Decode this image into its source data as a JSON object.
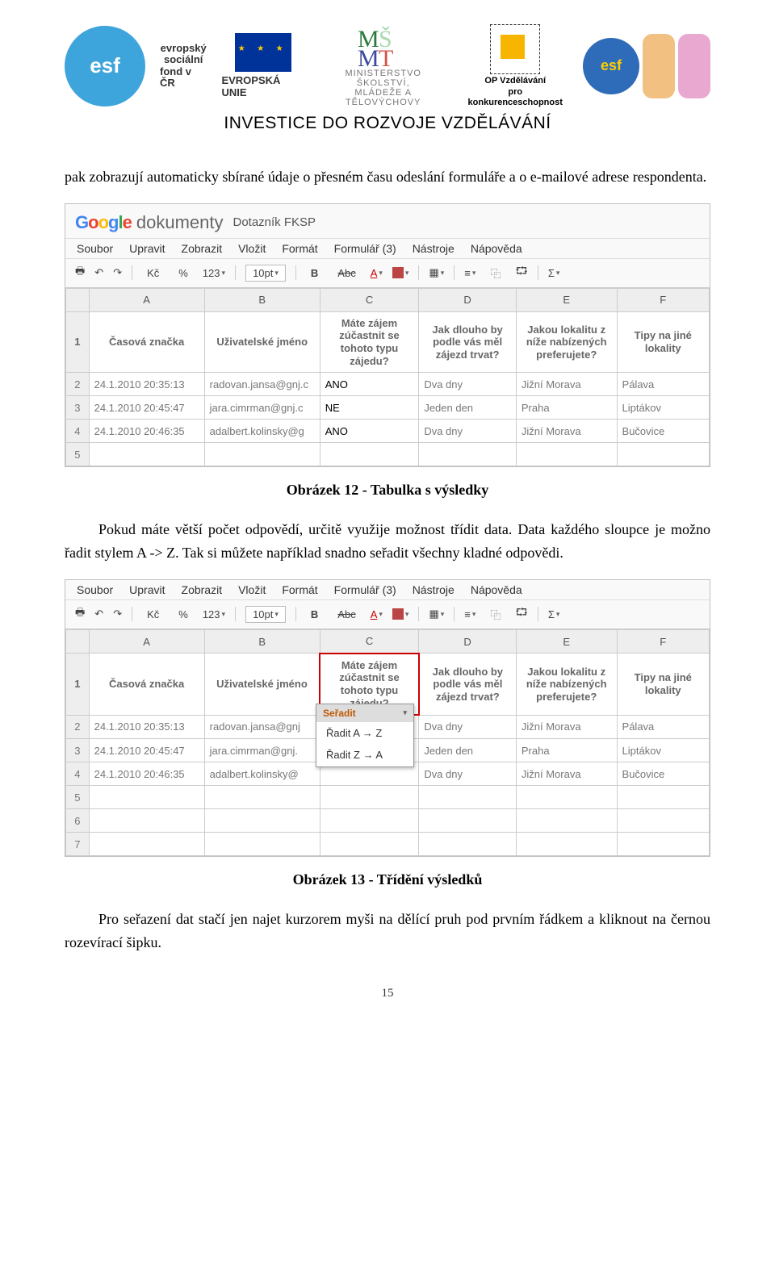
{
  "header": {
    "esf_label1": "evropský",
    "esf_label2": "sociální",
    "esf_label3": "fond v ČR",
    "eu_label": "EVROPSKÁ UNIE",
    "ministry_line1": "MINISTERSTVO ŠKOLSTVÍ,",
    "ministry_line2": "MLÁDEŽE A TĚLOVÝCHOVY",
    "op_line1": "OP Vzdělávání",
    "op_line2": "pro konkurenceschopnost",
    "esf_bubble": "esf",
    "invest": "INVESTICE DO ROZVOJE VZDĚLÁVÁNÍ"
  },
  "para1": "pak zobrazují automaticky sbírané údaje o přesném času odeslání formuláře a o e-mailové adrese respondenta.",
  "caption1": "Obrázek 12 - Tabulka s výsledky",
  "para2": "Pokud máte větší počet odpovědí, určitě využije možnost třídit data. Data každého sloupce je možno řadit stylem A -> Z. Tak si můžete například snadno seřadit všechny kladné odpovědi.",
  "caption2": "Obrázek 13 - Třídění výsledků",
  "para3": "Pro seřazení dat stačí jen najet kurzorem myši na dělící pruh pod prvním řádkem a kliknout na černou rozevírací šipku.",
  "page_num": "15",
  "google": {
    "docs_word": "dokumenty",
    "doc_title": "Dotazník FKSP",
    "menu": [
      "Soubor",
      "Upravit",
      "Zobrazit",
      "Vložit",
      "Formát",
      "Formulář (3)",
      "Nástroje",
      "Nápověda"
    ],
    "toolbar": {
      "kc": "Kč",
      "pct": "%",
      "num": "123",
      "font": "10pt",
      "bold": "B",
      "strike": "Abc",
      "a": "A",
      "sigma": "Σ"
    },
    "cols_letters": [
      "",
      "A",
      "B",
      "C",
      "D",
      "E",
      "F"
    ],
    "headers": {
      "r": "1",
      "a": "Časová značka",
      "b": "Uživatelské jméno",
      "c": "Máte zájem zúčastnit se tohoto typu zájedu?",
      "d": "Jak dlouho by podle vás měl zájezd trvat?",
      "e": "Jakou lokalitu z níže nabízených preferujete?",
      "f": "Tipy na jiné lokality"
    },
    "rows1": [
      {
        "r": "2",
        "a": "24.1.2010 20:35:13",
        "b": "radovan.jansa@gnj.c",
        "c": "ANO",
        "d": "Dva dny",
        "e": "Jižní Morava",
        "f": "Pálava"
      },
      {
        "r": "3",
        "a": "24.1.2010 20:45:47",
        "b": "jara.cimrman@gnj.c",
        "c": "NE",
        "d": "Jeden den",
        "e": "Praha",
        "f": "Liptákov"
      },
      {
        "r": "4",
        "a": "24.1.2010 20:46:35",
        "b": "adalbert.kolinsky@g",
        "c": "ANO",
        "d": "Dva dny",
        "e": "Jižní Morava",
        "f": "Bučovice"
      },
      {
        "r": "5",
        "a": "",
        "b": "",
        "c": "",
        "d": "",
        "e": "",
        "f": ""
      }
    ],
    "rows2": [
      {
        "r": "2",
        "a": "24.1.2010 20:35:13",
        "b": "radovan.jansa@gnj",
        "c": "",
        "d": "Dva dny",
        "e": "Jižní Morava",
        "f": "Pálava"
      },
      {
        "r": "3",
        "a": "24.1.2010 20:45:47",
        "b": "jara.cimrman@gnj.",
        "c": "",
        "d": "Jeden den",
        "e": "Praha",
        "f": "Liptákov"
      },
      {
        "r": "4",
        "a": "24.1.2010 20:46:35",
        "b": "adalbert.kolinsky@",
        "c": "",
        "d": "Dva dny",
        "e": "Jižní Morava",
        "f": "Bučovice"
      },
      {
        "r": "5",
        "a": "",
        "b": "",
        "c": "",
        "d": "",
        "e": "",
        "f": ""
      },
      {
        "r": "6",
        "a": "",
        "b": "",
        "c": "",
        "d": "",
        "e": "",
        "f": ""
      },
      {
        "r": "7",
        "a": "",
        "b": "",
        "c": "",
        "d": "",
        "e": "",
        "f": ""
      }
    ],
    "sort": {
      "title": "Seřadit",
      "opt1": "Řadit A → Z",
      "opt2": "Řadit Z → A"
    }
  }
}
